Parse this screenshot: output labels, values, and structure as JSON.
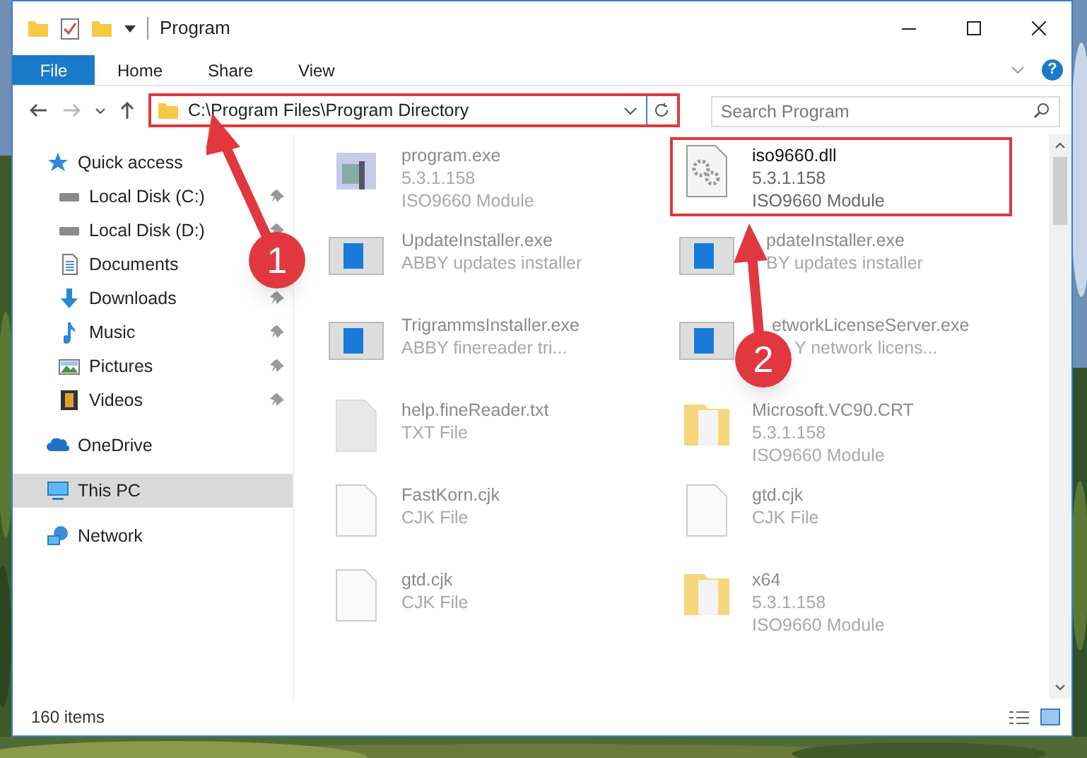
{
  "window": {
    "title": "Program"
  },
  "ribbon": {
    "tabs": [
      {
        "label": "File",
        "kind": "file"
      },
      {
        "label": "Home",
        "kind": "tab"
      },
      {
        "label": "Share",
        "kind": "tab"
      },
      {
        "label": "View",
        "kind": "tab"
      }
    ],
    "help": "?"
  },
  "address_bar": {
    "path": "C:\\Program Files\\Program Directory",
    "highlighted": true
  },
  "search": {
    "placeholder": "Search Program"
  },
  "sidebar": {
    "items": [
      {
        "label": "Quick access",
        "selected": false,
        "children": [
          {
            "label": "Local Disk (C:)",
            "pinned": true
          },
          {
            "label": "Local Disk (D:)",
            "pinned": true
          },
          {
            "label": "Documents"
          },
          {
            "label": "Downloads",
            "pinned": true
          },
          {
            "label": "Music",
            "pinned": true
          },
          {
            "label": "Pictures",
            "pinned": true
          },
          {
            "label": "Videos",
            "pinned": true
          }
        ]
      },
      {
        "label": "OneDrive",
        "selected": false
      },
      {
        "label": "This PC",
        "selected": true
      },
      {
        "label": "Network",
        "selected": false
      }
    ]
  },
  "files": [
    {
      "kind": "exe",
      "faded": true,
      "highlighted": false,
      "lines": [
        "program.exe",
        "5.3.1.158",
        "ISO9660 Module"
      ]
    },
    {
      "kind": "dll",
      "faded": false,
      "highlighted": true,
      "lines": [
        "iso9660.dll",
        "5.3.1.158",
        "ISO9660 Module"
      ]
    },
    {
      "kind": "installer",
      "faded": true,
      "highlighted": false,
      "lines": [
        "UpdateInstaller.exe",
        "ABBY updates installer"
      ]
    },
    {
      "kind": "installer",
      "faded": true,
      "highlighted": false,
      "lines": [
        "pdateInstaller.exe",
        "BY updates installer"
      ]
    },
    {
      "kind": "installer",
      "faded": true,
      "highlighted": false,
      "lines": [
        "TrigrammsInstaller.exe",
        "ABBY finereader tri..."
      ]
    },
    {
      "kind": "installer",
      "faded": true,
      "highlighted": false,
      "lines": [
        "etworkLicenseServer.exe",
        "Y network licens..."
      ]
    },
    {
      "kind": "text",
      "faded": true,
      "highlighted": false,
      "lines": [
        "help.fineReader.txt",
        "TXT File"
      ]
    },
    {
      "kind": "folder",
      "faded": true,
      "highlighted": false,
      "lines": [
        "Microsoft.VC90.CRT",
        "5.3.1.158",
        "ISO9660 Module"
      ]
    },
    {
      "kind": "blank",
      "faded": true,
      "highlighted": false,
      "lines": [
        "FastKorn.cjk",
        "CJK File"
      ]
    },
    {
      "kind": "blank",
      "faded": true,
      "highlighted": false,
      "lines": [
        "gtd.cjk",
        "CJK File"
      ]
    },
    {
      "kind": "blank",
      "faded": true,
      "highlighted": false,
      "lines": [
        "gtd.cjk",
        "CJK File"
      ]
    },
    {
      "kind": "folder",
      "faded": true,
      "highlighted": false,
      "lines": [
        "x64",
        "5.3.1.158",
        "ISO9660 Module"
      ]
    }
  ],
  "status_bar": {
    "count": "160 items"
  },
  "annotations": [
    {
      "number": "1"
    },
    {
      "number": "2"
    }
  ]
}
